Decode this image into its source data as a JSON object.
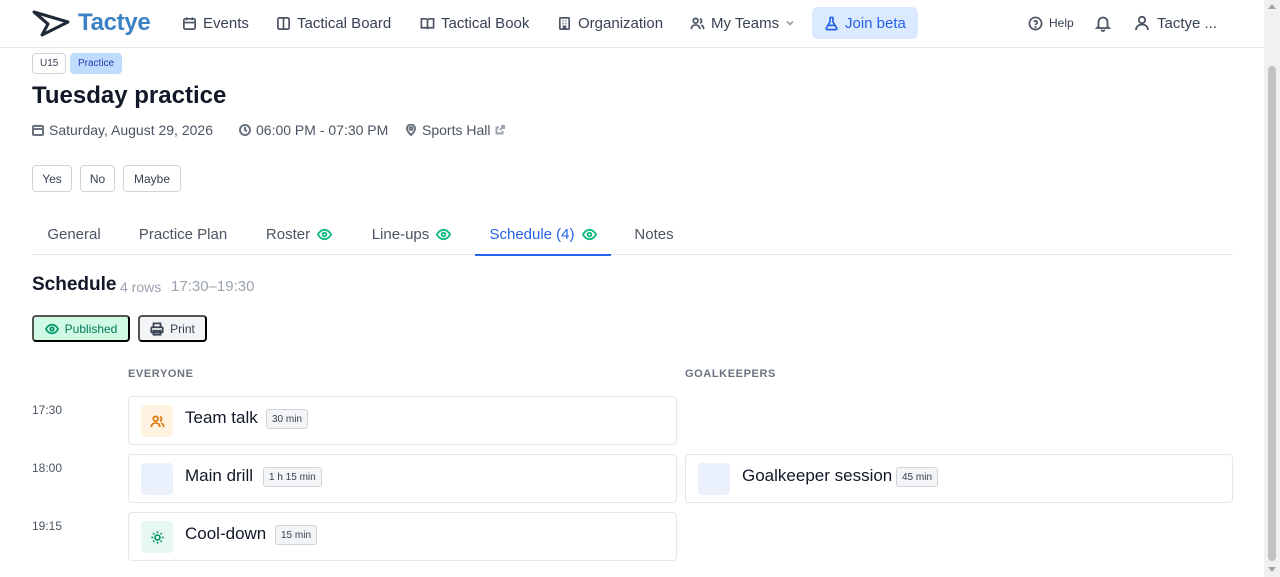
{
  "nav": {
    "brand": "Tactye",
    "items": [
      {
        "label": "Events",
        "icon": "calendar-icon"
      },
      {
        "label": "Tactical Board",
        "icon": "board-icon"
      },
      {
        "label": "Tactical Book",
        "icon": "book-icon"
      },
      {
        "label": "Organization",
        "icon": "building-icon"
      },
      {
        "label": "My Teams",
        "icon": "users-icon"
      }
    ],
    "beta_label": "Join beta",
    "help_label": "Help",
    "user_label": "Tactye ..."
  },
  "event": {
    "age_group": "U15",
    "type": "Practice",
    "title": "Tuesday practice",
    "date": "Saturday, August 29, 2026",
    "time": "06:00 PM - 07:30 PM",
    "location": "Sports Hall"
  },
  "rsvp": {
    "yes": "Yes",
    "no": "No",
    "maybe": "Maybe"
  },
  "tabs": [
    {
      "label": "General",
      "published": false
    },
    {
      "label": "Practice Plan",
      "published": false
    },
    {
      "label": "Roster",
      "published": true
    },
    {
      "label": "Line-ups",
      "published": true
    },
    {
      "label": "Schedule (4)",
      "published": true,
      "active": true
    },
    {
      "label": "Notes",
      "published": false
    }
  ],
  "schedule": {
    "title": "Schedule",
    "rows_label": "4 rows",
    "range": "17:30–19:30",
    "published_label": "Published",
    "print_label": "Print",
    "columns": [
      "EVERYONE",
      "GOALKEEPERS"
    ],
    "times": [
      "17:30",
      "18:00",
      "19:15"
    ],
    "blocks": [
      {
        "name": "Team talk",
        "duration": "30 min",
        "icon": "users-icon",
        "icon_color": "#d97706",
        "icon_bg": "#fef3e2"
      },
      {
        "name": "Main drill",
        "duration": "1 h 15 min",
        "icon": "",
        "icon_bg": "#eaf1fd"
      },
      {
        "name": "Goalkeeper session",
        "duration": "45 min",
        "icon": "",
        "icon_bg": "#eaf1fd"
      },
      {
        "name": "Cool-down",
        "duration": "15 min",
        "icon": "sun-icon",
        "icon_color": "#059669",
        "icon_bg": "#e6f8ef"
      }
    ]
  },
  "colors": {
    "brand": "#3b82c4",
    "accent": "#2563eb",
    "published": "#10b981"
  }
}
